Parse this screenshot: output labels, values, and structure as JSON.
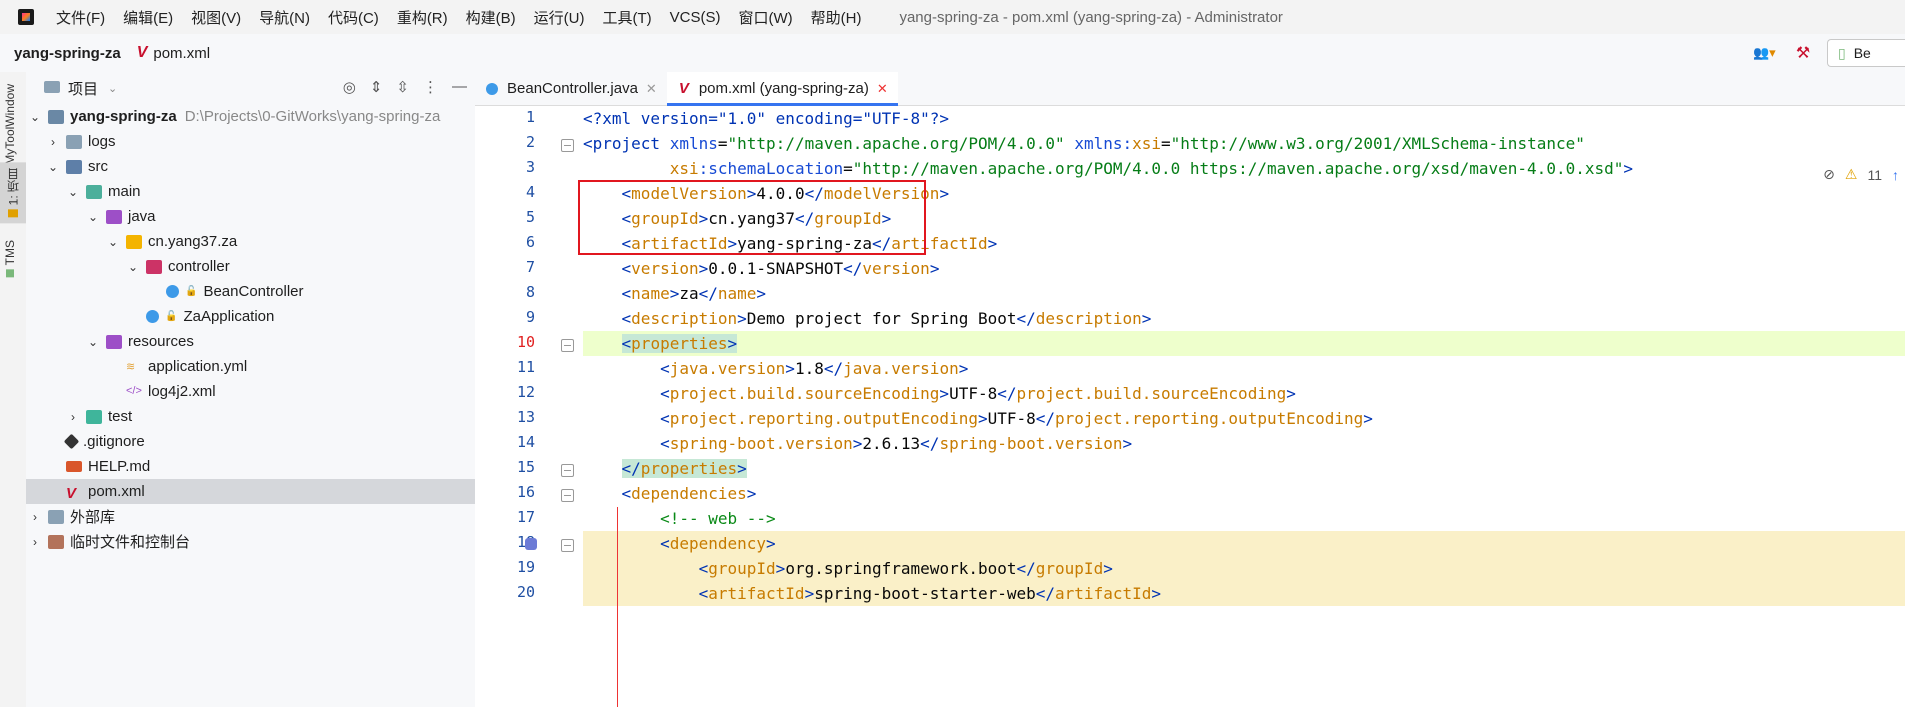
{
  "menubar": {
    "items": [
      "文件(F)",
      "编辑(E)",
      "视图(V)",
      "导航(N)",
      "代码(C)",
      "重构(R)",
      "构建(B)",
      "运行(U)",
      "工具(T)",
      "VCS(S)",
      "窗口(W)",
      "帮助(H)"
    ],
    "window_title": "yang-spring-za - pom.xml (yang-spring-za) - Administrator"
  },
  "navbar": {
    "project": "yang-spring-za",
    "file": "pom.xml",
    "run_config": "Be"
  },
  "left_strip": {
    "tabs": [
      "MyToolWindow",
      "1: 项目",
      "TMS"
    ]
  },
  "project_panel": {
    "title": "项目",
    "tree": [
      {
        "label": "yang-spring-za",
        "extra": "D:\\Projects\\0-GitWorks\\yang-spring-za",
        "bold": true
      },
      {
        "label": "logs"
      },
      {
        "label": "src"
      },
      {
        "label": "main"
      },
      {
        "label": "java"
      },
      {
        "label": "cn.yang37.za"
      },
      {
        "label": "controller"
      },
      {
        "label": "BeanController"
      },
      {
        "label": "ZaApplication"
      },
      {
        "label": "resources"
      },
      {
        "label": "application.yml"
      },
      {
        "label": "log4j2.xml"
      },
      {
        "label": "test"
      },
      {
        "label": ".gitignore"
      },
      {
        "label": "HELP.md"
      },
      {
        "label": "pom.xml"
      },
      {
        "label": "外部库"
      },
      {
        "label": "临时文件和控制台"
      }
    ]
  },
  "editor": {
    "tabs": [
      {
        "label": "BeanController.java"
      },
      {
        "label": "pom.xml (yang-spring-za)"
      }
    ],
    "warnings": "11",
    "line_numbers": [
      "1",
      "2",
      "3",
      "4",
      "5",
      "6",
      "7",
      "8",
      "9",
      "10",
      "11",
      "12",
      "13",
      "14",
      "15",
      "16",
      "17",
      "18",
      "19",
      "20"
    ],
    "code": {
      "l1_a": "<?xml version=\"1.0\" encoding=\"UTF-8\"?>",
      "l2_attr_val1": "\"http://maven.apache.org/POM/4.0.0\"",
      "l2_attr_val2": "\"http://www.w3.org/2001/XMLSchema-instance\"",
      "l3_attr_val": "\"http://maven.apache.org/POM/4.0.0 https://maven.apache.org/xsd/maven-4.0.0.xsd\"",
      "model_version": "4.0.0",
      "group_id": "cn.yang37",
      "artifact_id": "yang-spring-za",
      "version": "0.0.1-SNAPSHOT",
      "name": "za",
      "description": "Demo project for Spring Boot",
      "java_version": "1.8",
      "source_encoding": "UTF-8",
      "output_encoding": "UTF-8",
      "spring_boot_version": "2.6.13",
      "comment_web": "<!-- web -->",
      "dep_group": "org.springframework.boot",
      "dep_artifact": "spring-boot-starter-web"
    }
  }
}
